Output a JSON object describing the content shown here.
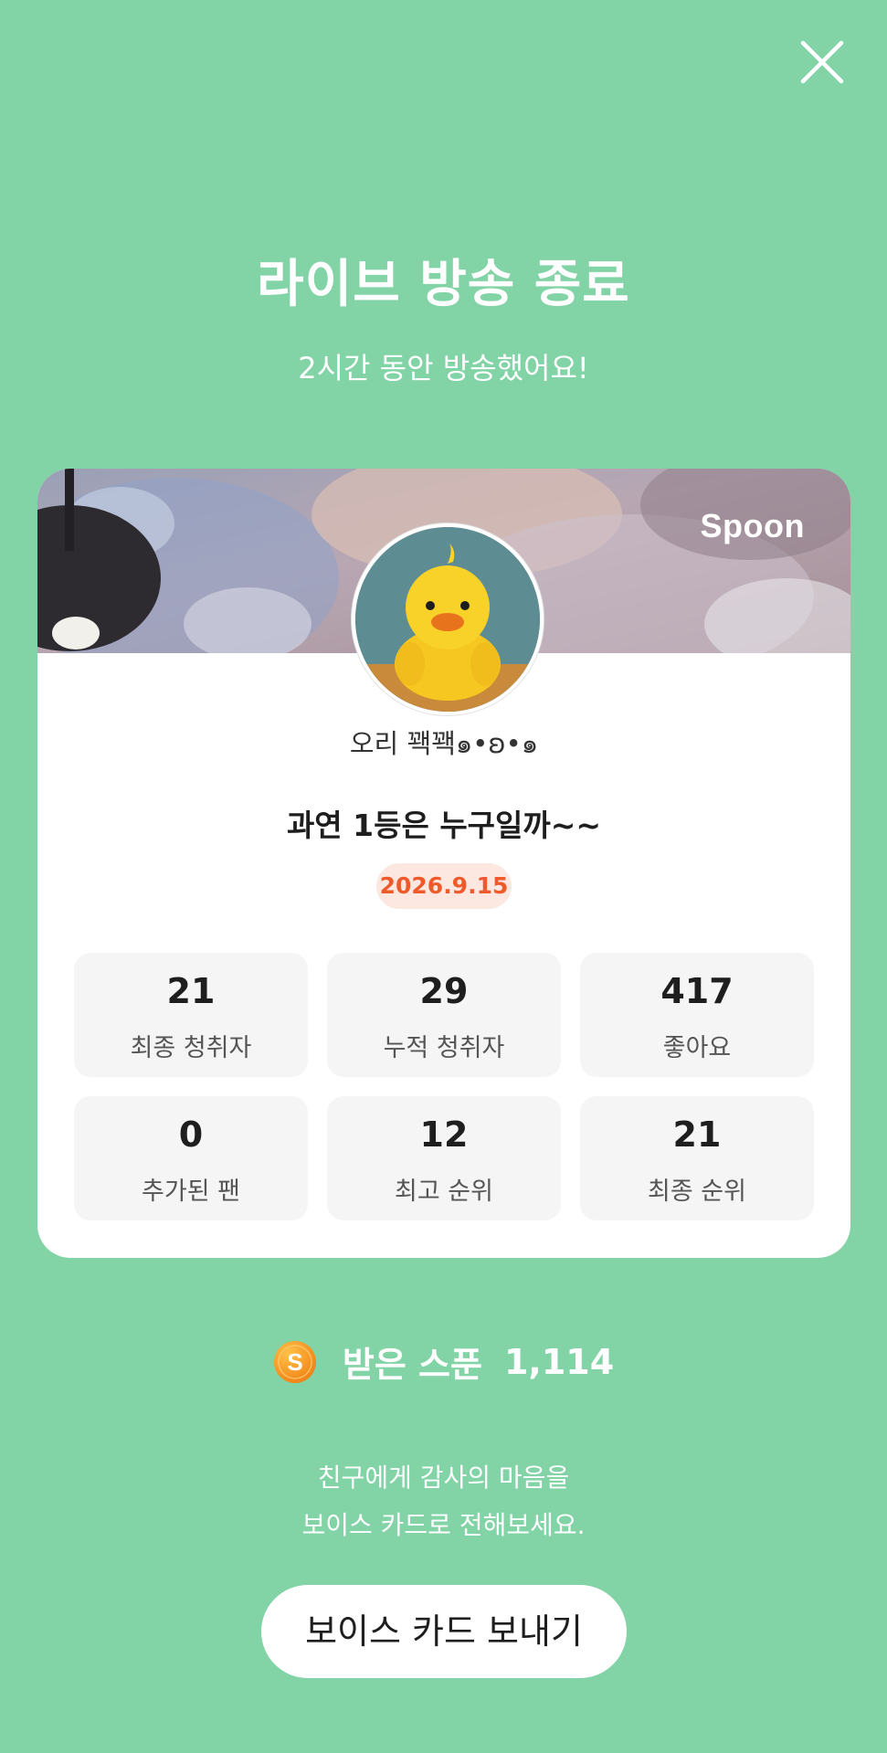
{
  "header": {
    "close_icon": "close-icon",
    "title": "라이브 방송 종료",
    "subtitle": "2시간 동안 방송했어요!"
  },
  "card": {
    "brand": "Spoon",
    "nickname": "오리 꽥꽥๑•ʚ•๑",
    "live_title": "과연 1등은 누구일까~~",
    "date": "2026.9.15",
    "stats": [
      {
        "value": "21",
        "label": "최종 청취자"
      },
      {
        "value": "29",
        "label": "누적 청취자"
      },
      {
        "value": "417",
        "label": "좋아요"
      },
      {
        "value": "0",
        "label": "추가된 팬"
      },
      {
        "value": "12",
        "label": "최고 순위"
      },
      {
        "value": "21",
        "label": "최종 순위"
      }
    ]
  },
  "received_spoon": {
    "icon": "spoon-coin-icon",
    "label": "받은 스푼",
    "value": "1,114"
  },
  "message": {
    "line1": "친구에게 감사의 마음을",
    "line2": "보이스 카드로 전해보세요."
  },
  "actions": {
    "send_voice_card": "보이스 카드 보내기"
  },
  "colors": {
    "background": "#82d3a6",
    "badge_bg": "#fde7e1",
    "badge_text": "#ef5a2b",
    "stat_bg": "#f5f5f5",
    "coin": "#f7931e"
  }
}
